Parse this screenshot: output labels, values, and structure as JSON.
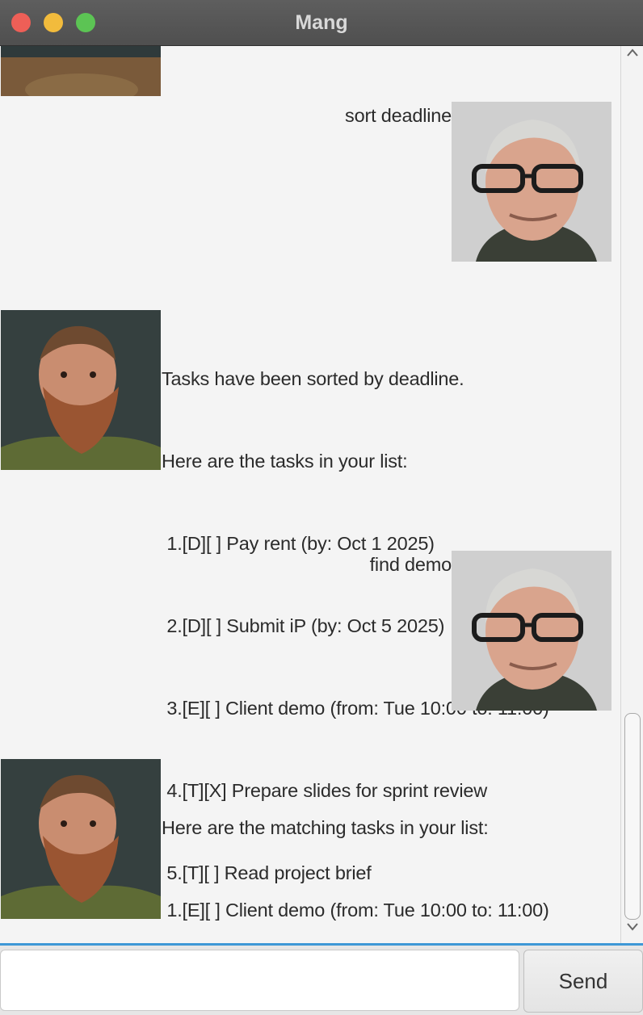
{
  "window": {
    "title": "Mang"
  },
  "messages": {
    "user1": {
      "text": "sort deadline"
    },
    "bot1": {
      "lines": [
        "Tasks have been sorted by deadline.",
        "Here are the tasks in your list:",
        " 1.[D][ ] Pay rent (by: Oct 1 2025)",
        " 2.[D][ ] Submit iP (by: Oct 5 2025)",
        " 3.[E][ ] Client demo (from: Tue 10:00 to: 11:00)",
        " 4.[T][X] Prepare slides for sprint review",
        " 5.[T][ ] Read project brief"
      ]
    },
    "user2": {
      "text": "find demo"
    },
    "bot2": {
      "lines": [
        "Here are the matching tasks in your list:",
        " 1.[E][ ] Client demo (from: Tue 10:00 to: 11:00)"
      ]
    }
  },
  "input": {
    "value": "",
    "placeholder": ""
  },
  "send_button": {
    "label": "Send"
  },
  "colors": {
    "titlebar": "#555555",
    "close": "#ee5f57",
    "minimize": "#f2bb3c",
    "zoom": "#5cc454",
    "chat_bg": "#f4f4f4",
    "focus_accent": "#3e98d6"
  },
  "icons": {
    "user_avatar": "user-avatar-image",
    "bot_avatar": "bot-avatar-image",
    "scroll_up": "chevron-up-icon",
    "scroll_down": "chevron-down-icon"
  }
}
